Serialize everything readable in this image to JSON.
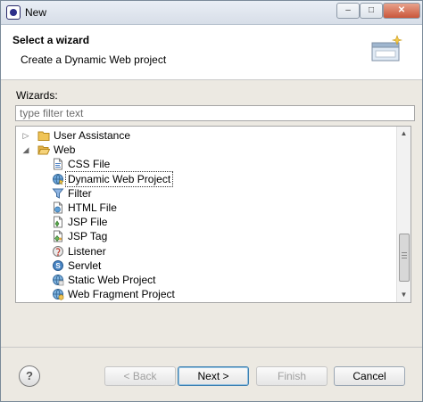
{
  "window": {
    "title": "New",
    "controls": [
      "–",
      "□",
      "✕"
    ]
  },
  "header": {
    "title": "Select a wizard",
    "description": "Create a Dynamic Web project"
  },
  "wizards": {
    "label": "Wizards:",
    "filter_placeholder": "type filter text",
    "tree": [
      {
        "label": "User Assistance",
        "icon": "folder-icon",
        "level": 0,
        "expanded": false
      },
      {
        "label": "Web",
        "icon": "folder-open-icon",
        "level": 0,
        "expanded": true
      },
      {
        "label": "CSS File",
        "icon": "css-file-icon",
        "level": 1
      },
      {
        "label": "Dynamic Web Project",
        "icon": "dynamic-web-project-icon",
        "level": 1,
        "selected": true
      },
      {
        "label": "Filter",
        "icon": "filter-icon",
        "level": 1
      },
      {
        "label": "HTML File",
        "icon": "html-file-icon",
        "level": 1
      },
      {
        "label": "JSP File",
        "icon": "jsp-file-icon",
        "level": 1
      },
      {
        "label": "JSP Tag",
        "icon": "jsp-tag-icon",
        "level": 1
      },
      {
        "label": "Listener",
        "icon": "listener-icon",
        "level": 1
      },
      {
        "label": "Servlet",
        "icon": "servlet-icon",
        "level": 1
      },
      {
        "label": "Static Web Project",
        "icon": "static-web-project-icon",
        "level": 1
      },
      {
        "label": "Web Fragment Project",
        "icon": "web-fragment-project-icon",
        "level": 1
      }
    ]
  },
  "buttons": {
    "help": "?",
    "back": "< Back",
    "next": "Next >",
    "finish": "Finish",
    "cancel": "Cancel"
  },
  "colors": {
    "selection_outline": "#333333",
    "primary_button_border": "#3c7fb1",
    "folder": "#e8b84a"
  }
}
